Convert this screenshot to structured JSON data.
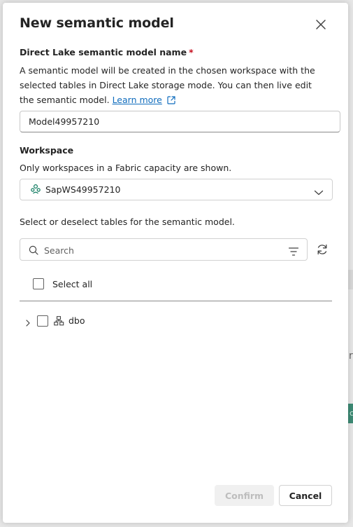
{
  "dialog": {
    "title": "New semantic model",
    "close_icon": "close-icon"
  },
  "model_name": {
    "label": "Direct Lake semantic model name",
    "required_marker": "*",
    "description_before_link": "A semantic model will be created in the chosen workspace with the selected tables in Direct Lake storage mode. You can then live edit the semantic model.",
    "learn_more_label": "Learn more",
    "learn_more_icon": "external-link-icon",
    "value": "Model49957210"
  },
  "workspace": {
    "label": "Workspace",
    "hint": "Only workspaces in a Fabric capacity are shown.",
    "selected": "SapWS49957210",
    "workspace_icon": "workspace-icon",
    "chevron_icon": "chevron-down-icon"
  },
  "tables": {
    "instruction": "Select or deselect tables for the semantic model.",
    "search_placeholder": "Search",
    "search_icon": "search-icon",
    "filter_icon": "filter-icon",
    "refresh_icon": "refresh-icon",
    "select_all_label": "Select all",
    "select_all_checked": false,
    "tree": [
      {
        "label": "dbo",
        "expanded": false,
        "checked": false,
        "icon": "schema-icon"
      }
    ]
  },
  "footer": {
    "confirm_label": "Confirm",
    "confirm_enabled": false,
    "cancel_label": "Cancel"
  },
  "colors": {
    "link": "#0f6cbd",
    "required": "#c50f1f",
    "workspace_icon": "#0e7a5f"
  }
}
